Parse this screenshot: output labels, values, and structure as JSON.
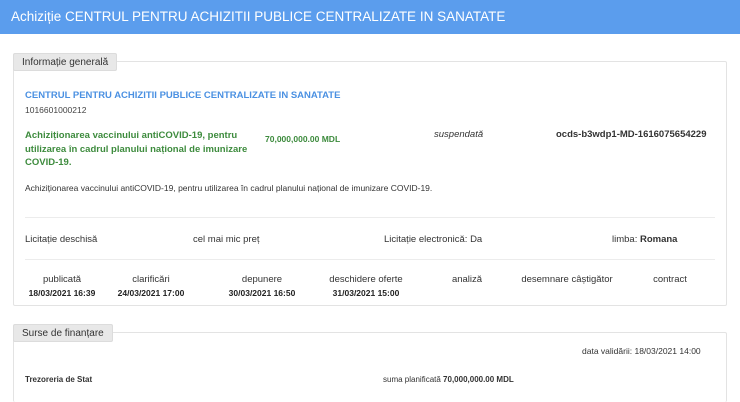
{
  "header": {
    "title": "Achiziție CENTRUL PENTRU ACHIZITII PUBLICE CENTRALIZATE IN SANATATE"
  },
  "general": {
    "tab_label": "Informație generală",
    "buyer_name": "CENTRUL PENTRU ACHIZITII PUBLICE CENTRALIZATE IN SANATATE",
    "buyer_id": "1016601000212",
    "tender_title": "Achiziționarea vaccinului antiCOVID-19, pentru utilizarea în cadrul planului național de imunizare COVID-19.",
    "tender_value": "70,000,000.00 MDL",
    "status": "suspendată",
    "ocid": "ocds-b3wdp1-MD-1616075654229",
    "description": "Achiziționarea vaccinului antiCOVID-19, pentru utilizarea în cadrul planului național de imunizare COVID-19.",
    "procurement_method": "Licitație deschisă",
    "award_criteria": "cel mai mic preț",
    "e_auction": "Licitație electronică: Da",
    "language_label": "limba:",
    "language_value": "Romana"
  },
  "stages": [
    {
      "label": "publicată",
      "date": "18/03/2021 16:39"
    },
    {
      "label": "clarificări",
      "date": "24/03/2021 17:00"
    },
    {
      "label": "depunere",
      "date": "30/03/2021 16:50"
    },
    {
      "label": "deschidere oferte",
      "date": "31/03/2021 15:00"
    },
    {
      "label": "analiză",
      "date": ""
    },
    {
      "label": "desemnare câștigător",
      "date": ""
    },
    {
      "label": "contract",
      "date": ""
    }
  ],
  "funding": {
    "tab_label": "Surse de finanțare",
    "validation_label": "data validării:",
    "validation_date": "18/03/2021 14:00",
    "source_name": "Trezoreria de Stat",
    "planned_label": "suma planificată",
    "planned_value": "70,000,000.00 MDL"
  }
}
